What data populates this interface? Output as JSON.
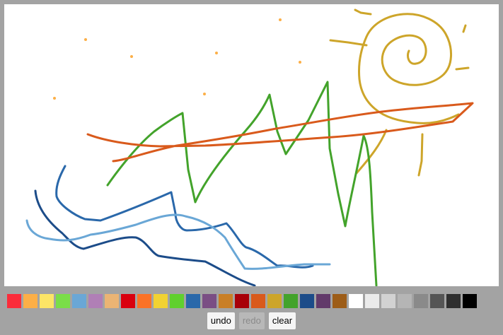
{
  "palette": [
    {
      "name": "red",
      "color": "#fb2c3a"
    },
    {
      "name": "light-orange",
      "color": "#fcaf47"
    },
    {
      "name": "light-yellow",
      "color": "#fce566"
    },
    {
      "name": "light-green",
      "color": "#7ade48"
    },
    {
      "name": "light-blue",
      "color": "#6aa7d6"
    },
    {
      "name": "light-purple",
      "color": "#b07fb6"
    },
    {
      "name": "tan",
      "color": "#ebb474"
    },
    {
      "name": "crimson",
      "color": "#d9000f"
    },
    {
      "name": "orange",
      "color": "#fb7226"
    },
    {
      "name": "yellow",
      "color": "#f1d232"
    },
    {
      "name": "green",
      "color": "#60d02d"
    },
    {
      "name": "blue",
      "color": "#2a68aa"
    },
    {
      "name": "purple",
      "color": "#7a4e84"
    },
    {
      "name": "ochre",
      "color": "#c97f26"
    },
    {
      "name": "dark-red",
      "color": "#a80009"
    },
    {
      "name": "burnt-orange",
      "color": "#d95a1c"
    },
    {
      "name": "mustard",
      "color": "#cda52a"
    },
    {
      "name": "dark-green",
      "color": "#43a32b"
    },
    {
      "name": "navy",
      "color": "#1c4c89"
    },
    {
      "name": "plum",
      "color": "#623a6a"
    },
    {
      "name": "brown",
      "color": "#9d5d18"
    },
    {
      "name": "white",
      "color": "#ffffff"
    },
    {
      "name": "off-white",
      "color": "#ebebeb"
    },
    {
      "name": "light-gray",
      "color": "#d2d2d2"
    },
    {
      "name": "silver",
      "color": "#b5b5b5"
    },
    {
      "name": "gray",
      "color": "#8a8a8a"
    },
    {
      "name": "dark-gray",
      "color": "#555555"
    },
    {
      "name": "charcoal",
      "color": "#2f2f2f"
    },
    {
      "name": "black",
      "color": "#000000"
    }
  ],
  "toolbar": {
    "undo_label": "undo",
    "redo_label": "redo",
    "clear_label": "clear"
  }
}
